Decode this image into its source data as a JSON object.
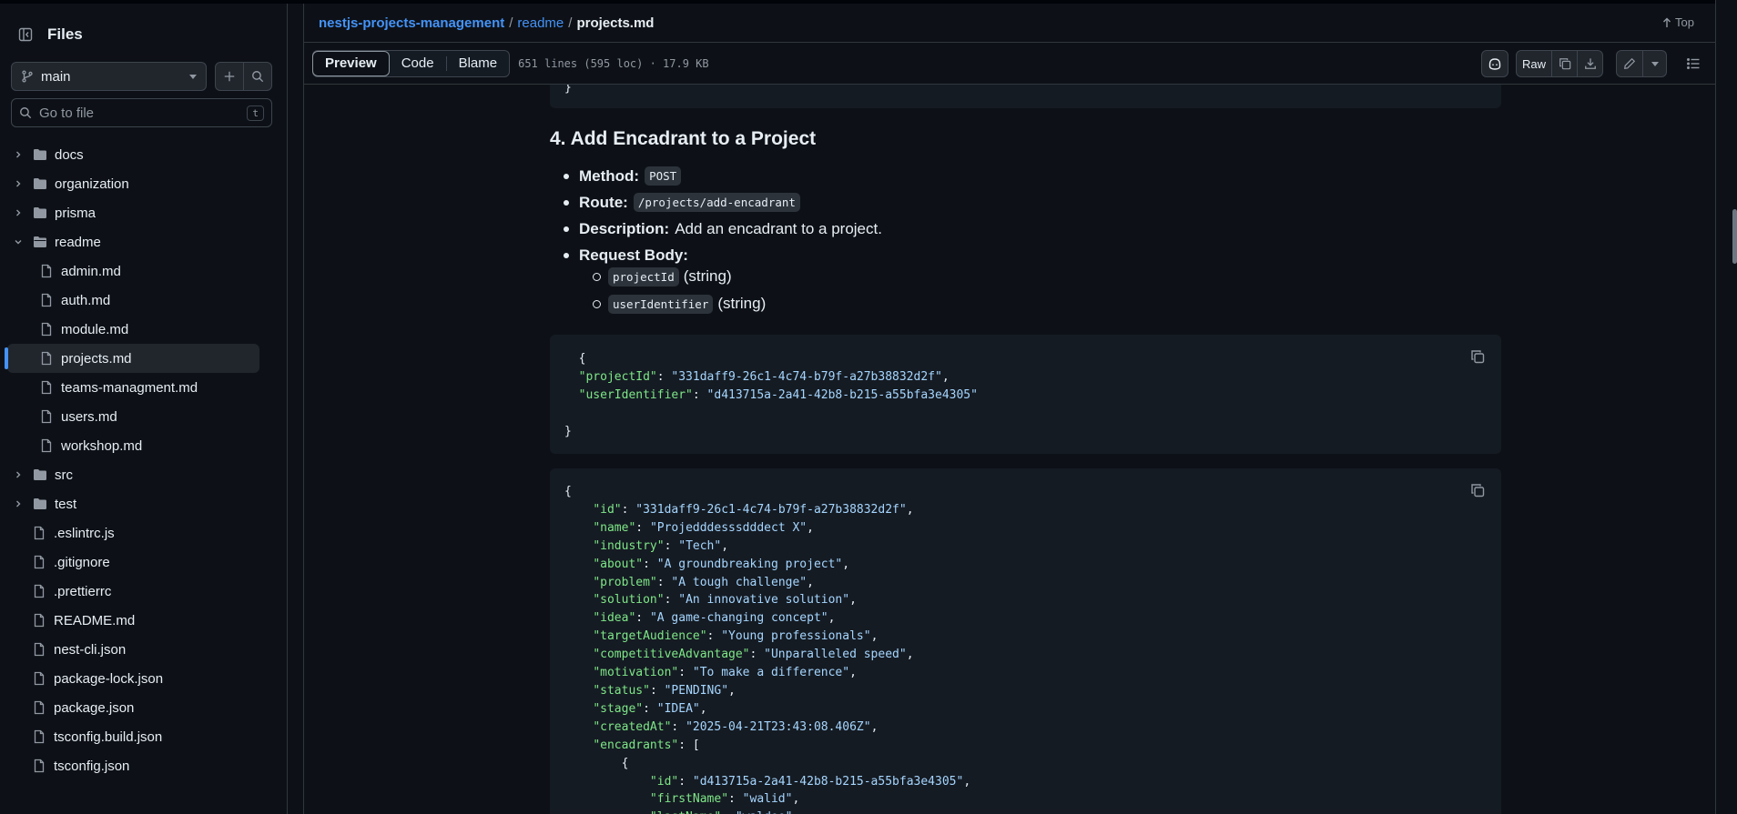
{
  "sidebar": {
    "title": "Files",
    "branch": "main",
    "goto_placeholder": "Go to file",
    "goto_shortcut": "t",
    "tree": [
      {
        "name": "docs",
        "type": "folder",
        "expanded": false
      },
      {
        "name": "organization",
        "type": "folder",
        "expanded": false
      },
      {
        "name": "prisma",
        "type": "folder",
        "expanded": false
      },
      {
        "name": "readme",
        "type": "folder",
        "expanded": true
      },
      {
        "name": "admin.md",
        "type": "file",
        "child": true
      },
      {
        "name": "auth.md",
        "type": "file",
        "child": true
      },
      {
        "name": "module.md",
        "type": "file",
        "child": true
      },
      {
        "name": "projects.md",
        "type": "file",
        "child": true,
        "active": true
      },
      {
        "name": "teams-managment.md",
        "type": "file",
        "child": true
      },
      {
        "name": "users.md",
        "type": "file",
        "child": true
      },
      {
        "name": "workshop.md",
        "type": "file",
        "child": true
      },
      {
        "name": "src",
        "type": "folder",
        "expanded": false
      },
      {
        "name": "test",
        "type": "folder",
        "expanded": false
      },
      {
        "name": ".eslintrc.js",
        "type": "file"
      },
      {
        "name": ".gitignore",
        "type": "file"
      },
      {
        "name": ".prettierrc",
        "type": "file"
      },
      {
        "name": "README.md",
        "type": "file"
      },
      {
        "name": "nest-cli.json",
        "type": "file"
      },
      {
        "name": "package-lock.json",
        "type": "file"
      },
      {
        "name": "package.json",
        "type": "file"
      },
      {
        "name": "tsconfig.build.json",
        "type": "file"
      },
      {
        "name": "tsconfig.json",
        "type": "file"
      }
    ]
  },
  "breadcrumb": {
    "repo": "nestjs-projects-management",
    "sep": "/",
    "folder": "readme",
    "file": "projects.md",
    "top_label": "Top"
  },
  "toolbar": {
    "tabs": [
      "Preview",
      "Code",
      "Blame"
    ],
    "file_info": "651 lines (595 loc) · 17.9 KB",
    "raw_label": "Raw"
  },
  "content": {
    "prev_code_tail": "}",
    "section_title": "4. Add Encadrant to a Project",
    "method_label": "Method:",
    "method_value": "POST",
    "route_label": "Route:",
    "route_value": "/projects/add-encadrant",
    "desc_label": "Description:",
    "desc_value": "Add an encadrant to a project.",
    "body_label": "Request Body:",
    "body_items": [
      {
        "code": "projectId",
        "type": "(string)"
      },
      {
        "code": "userIdentifier",
        "type": "(string)"
      }
    ],
    "request_code": [
      [
        {
          "t": "  {",
          "c": ""
        }
      ],
      [
        {
          "t": "  ",
          "c": ""
        },
        {
          "t": "\"projectId\"",
          "c": "k"
        },
        {
          "t": ": ",
          "c": ""
        },
        {
          "t": "\"331daff9-26c1-4c74-b79f-a27b38832d2f\"",
          "c": "s"
        },
        {
          "t": ",",
          "c": ""
        }
      ],
      [
        {
          "t": "  ",
          "c": ""
        },
        {
          "t": "\"userIdentifier\"",
          "c": "k"
        },
        {
          "t": ": ",
          "c": ""
        },
        {
          "t": "\"d413715a-2a41-42b8-b215-a55bfa3e4305\"",
          "c": "s"
        }
      ],
      [
        {
          "t": "",
          "c": ""
        }
      ],
      [
        {
          "t": "}",
          "c": ""
        }
      ]
    ],
    "response_code": [
      [
        {
          "t": "{",
          "c": ""
        }
      ],
      [
        {
          "t": "    ",
          "c": ""
        },
        {
          "t": "\"id\"",
          "c": "k"
        },
        {
          "t": ": ",
          "c": ""
        },
        {
          "t": "\"331daff9-26c1-4c74-b79f-a27b38832d2f\"",
          "c": "s"
        },
        {
          "t": ",",
          "c": ""
        }
      ],
      [
        {
          "t": "    ",
          "c": ""
        },
        {
          "t": "\"name\"",
          "c": "k"
        },
        {
          "t": ": ",
          "c": ""
        },
        {
          "t": "\"Projedddesssdddect X\"",
          "c": "s"
        },
        {
          "t": ",",
          "c": ""
        }
      ],
      [
        {
          "t": "    ",
          "c": ""
        },
        {
          "t": "\"industry\"",
          "c": "k"
        },
        {
          "t": ": ",
          "c": ""
        },
        {
          "t": "\"Tech\"",
          "c": "s"
        },
        {
          "t": ",",
          "c": ""
        }
      ],
      [
        {
          "t": "    ",
          "c": ""
        },
        {
          "t": "\"about\"",
          "c": "k"
        },
        {
          "t": ": ",
          "c": ""
        },
        {
          "t": "\"A groundbreaking project\"",
          "c": "s"
        },
        {
          "t": ",",
          "c": ""
        }
      ],
      [
        {
          "t": "    ",
          "c": ""
        },
        {
          "t": "\"problem\"",
          "c": "k"
        },
        {
          "t": ": ",
          "c": ""
        },
        {
          "t": "\"A tough challenge\"",
          "c": "s"
        },
        {
          "t": ",",
          "c": ""
        }
      ],
      [
        {
          "t": "    ",
          "c": ""
        },
        {
          "t": "\"solution\"",
          "c": "k"
        },
        {
          "t": ": ",
          "c": ""
        },
        {
          "t": "\"An innovative solution\"",
          "c": "s"
        },
        {
          "t": ",",
          "c": ""
        }
      ],
      [
        {
          "t": "    ",
          "c": ""
        },
        {
          "t": "\"idea\"",
          "c": "k"
        },
        {
          "t": ": ",
          "c": ""
        },
        {
          "t": "\"A game-changing concept\"",
          "c": "s"
        },
        {
          "t": ",",
          "c": ""
        }
      ],
      [
        {
          "t": "    ",
          "c": ""
        },
        {
          "t": "\"targetAudience\"",
          "c": "k"
        },
        {
          "t": ": ",
          "c": ""
        },
        {
          "t": "\"Young professionals\"",
          "c": "s"
        },
        {
          "t": ",",
          "c": ""
        }
      ],
      [
        {
          "t": "    ",
          "c": ""
        },
        {
          "t": "\"competitiveAdvantage\"",
          "c": "k"
        },
        {
          "t": ": ",
          "c": ""
        },
        {
          "t": "\"Unparalleled speed\"",
          "c": "s"
        },
        {
          "t": ",",
          "c": ""
        }
      ],
      [
        {
          "t": "    ",
          "c": ""
        },
        {
          "t": "\"motivation\"",
          "c": "k"
        },
        {
          "t": ": ",
          "c": ""
        },
        {
          "t": "\"To make a difference\"",
          "c": "s"
        },
        {
          "t": ",",
          "c": ""
        }
      ],
      [
        {
          "t": "    ",
          "c": ""
        },
        {
          "t": "\"status\"",
          "c": "k"
        },
        {
          "t": ": ",
          "c": ""
        },
        {
          "t": "\"PENDING\"",
          "c": "s"
        },
        {
          "t": ",",
          "c": ""
        }
      ],
      [
        {
          "t": "    ",
          "c": ""
        },
        {
          "t": "\"stage\"",
          "c": "k"
        },
        {
          "t": ": ",
          "c": ""
        },
        {
          "t": "\"IDEA\"",
          "c": "s"
        },
        {
          "t": ",",
          "c": ""
        }
      ],
      [
        {
          "t": "    ",
          "c": ""
        },
        {
          "t": "\"createdAt\"",
          "c": "k"
        },
        {
          "t": ": ",
          "c": ""
        },
        {
          "t": "\"2025-04-21T23:43:08.406Z\"",
          "c": "s"
        },
        {
          "t": ",",
          "c": ""
        }
      ],
      [
        {
          "t": "    ",
          "c": ""
        },
        {
          "t": "\"encadrants\"",
          "c": "k"
        },
        {
          "t": ": [",
          "c": ""
        }
      ],
      [
        {
          "t": "        {",
          "c": ""
        }
      ],
      [
        {
          "t": "            ",
          "c": ""
        },
        {
          "t": "\"id\"",
          "c": "k"
        },
        {
          "t": ": ",
          "c": ""
        },
        {
          "t": "\"d413715a-2a41-42b8-b215-a55bfa3e4305\"",
          "c": "s"
        },
        {
          "t": ",",
          "c": ""
        }
      ],
      [
        {
          "t": "            ",
          "c": ""
        },
        {
          "t": "\"firstName\"",
          "c": "k"
        },
        {
          "t": ": ",
          "c": ""
        },
        {
          "t": "\"walid\"",
          "c": "s"
        },
        {
          "t": ",",
          "c": ""
        }
      ],
      [
        {
          "t": "            ",
          "c": ""
        },
        {
          "t": "\"lastName\"",
          "c": "k"
        },
        {
          "t": ": ",
          "c": ""
        },
        {
          "t": "\"waldoo\"",
          "c": "s"
        },
        {
          "t": ",",
          "c": ""
        }
      ]
    ]
  },
  "colors": {
    "link": "#4493f8",
    "json_key": "#7ee787",
    "json_string": "#a5d6ff",
    "background": "#0d1117"
  }
}
